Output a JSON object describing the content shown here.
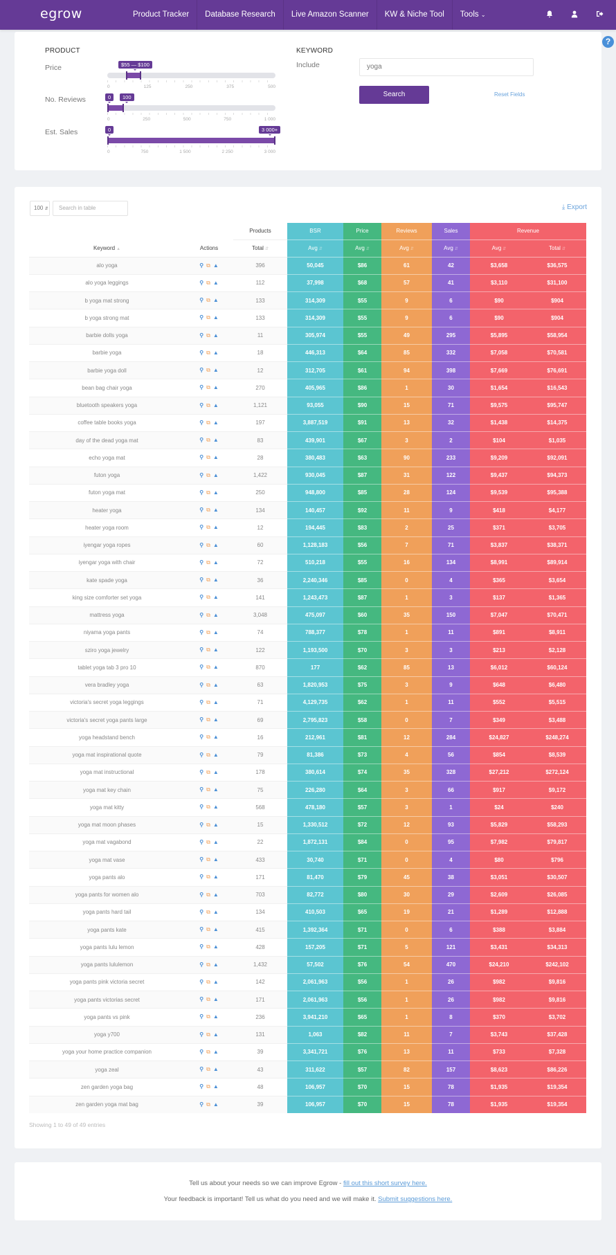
{
  "nav": {
    "logo": "egrow",
    "items": [
      "Product Tracker",
      "Database Research",
      "Live Amazon Scanner",
      "KW & Niche Tool",
      "Tools"
    ],
    "icons": [
      "bell-icon",
      "user-icon",
      "logout-icon"
    ]
  },
  "filters": {
    "product_title": "PRODUCT",
    "keyword_title": "KEYWORD",
    "price": {
      "label": "Price",
      "badge": "$55 — $100",
      "range": [
        55,
        100
      ],
      "max": 500,
      "ticks": [
        "0",
        "125",
        "250",
        "375",
        "500"
      ]
    },
    "reviews": {
      "label": "No. Reviews",
      "badge_min": "0",
      "badge_max": "100",
      "range": [
        0,
        100
      ],
      "max": 1000,
      "ticks": [
        "0",
        "250",
        "500",
        "750",
        "1 000"
      ]
    },
    "sales": {
      "label": "Est. Sales",
      "badge_min": "0",
      "badge_max": "3 000+",
      "range": [
        0,
        3000
      ],
      "max": 3000,
      "ticks": [
        "0",
        "750",
        "1 500",
        "2 250",
        "3 000"
      ]
    },
    "include_label": "Include",
    "include_value": "yoga",
    "search_button": "Search",
    "reset_link": "Reset Fields"
  },
  "table": {
    "page_length": "100",
    "search_placeholder": "Search in table",
    "export_label": "Export",
    "group_headers": {
      "products": "Products",
      "bsr": "BSR",
      "price": "Price",
      "reviews": "Reviews",
      "sales": "Sales",
      "revenue": "Revenue"
    },
    "columns": {
      "keyword": "Keyword",
      "actions": "Actions",
      "total": "Total",
      "bsr_avg": "Avg",
      "price_avg": "Avg",
      "reviews_avg": "Avg",
      "sales_avg": "Avg",
      "revenue_avg": "Avg",
      "revenue_total": "Total"
    },
    "colors": {
      "bsr": "#5bc5d1",
      "price": "#45b880",
      "reviews": "#f0a05a",
      "sales": "#8e68d3",
      "revenue": "#f3636b"
    },
    "rows": [
      [
        "alo yoga",
        "396",
        "50,045",
        "$86",
        "61",
        "42",
        "$3,658",
        "$36,575"
      ],
      [
        "alo yoga leggings",
        "112",
        "37,998",
        "$68",
        "57",
        "41",
        "$3,110",
        "$31,100"
      ],
      [
        "b yoga mat strong",
        "133",
        "314,309",
        "$55",
        "9",
        "6",
        "$90",
        "$904"
      ],
      [
        "b yoga strong mat",
        "133",
        "314,309",
        "$55",
        "9",
        "6",
        "$90",
        "$904"
      ],
      [
        "barbie dolls yoga",
        "11",
        "305,974",
        "$55",
        "49",
        "295",
        "$5,895",
        "$58,954"
      ],
      [
        "barbie yoga",
        "18",
        "446,313",
        "$64",
        "85",
        "332",
        "$7,058",
        "$70,581"
      ],
      [
        "barbie yoga doll",
        "12",
        "312,705",
        "$61",
        "94",
        "398",
        "$7,669",
        "$76,691"
      ],
      [
        "bean bag chair yoga",
        "270",
        "405,965",
        "$86",
        "1",
        "30",
        "$1,654",
        "$16,543"
      ],
      [
        "bluetooth speakers yoga",
        "1,121",
        "93,055",
        "$90",
        "15",
        "71",
        "$9,575",
        "$95,747"
      ],
      [
        "coffee table books yoga",
        "197",
        "3,887,519",
        "$91",
        "13",
        "32",
        "$1,438",
        "$14,375"
      ],
      [
        "day of the dead yoga mat",
        "83",
        "439,901",
        "$67",
        "3",
        "2",
        "$104",
        "$1,035"
      ],
      [
        "echo yoga mat",
        "28",
        "380,483",
        "$63",
        "90",
        "233",
        "$9,209",
        "$92,091"
      ],
      [
        "futon yoga",
        "1,422",
        "930,045",
        "$87",
        "31",
        "122",
        "$9,437",
        "$94,373"
      ],
      [
        "futon yoga mat",
        "250",
        "948,800",
        "$85",
        "28",
        "124",
        "$9,539",
        "$95,388"
      ],
      [
        "heater yoga",
        "134",
        "140,457",
        "$92",
        "11",
        "9",
        "$418",
        "$4,177"
      ],
      [
        "heater yoga room",
        "12",
        "194,445",
        "$83",
        "2",
        "25",
        "$371",
        "$3,705"
      ],
      [
        "iyengar yoga ropes",
        "60",
        "1,128,183",
        "$56",
        "7",
        "71",
        "$3,837",
        "$38,371"
      ],
      [
        "iyengar yoga with chair",
        "72",
        "510,218",
        "$55",
        "16",
        "134",
        "$8,991",
        "$89,914"
      ],
      [
        "kate spade yoga",
        "36",
        "2,240,346",
        "$85",
        "0",
        "4",
        "$365",
        "$3,654"
      ],
      [
        "king size comforter set yoga",
        "141",
        "1,243,473",
        "$87",
        "1",
        "3",
        "$137",
        "$1,365"
      ],
      [
        "mattress yoga",
        "3,048",
        "475,097",
        "$60",
        "35",
        "150",
        "$7,047",
        "$70,471"
      ],
      [
        "niyama yoga pants",
        "74",
        "788,377",
        "$78",
        "1",
        "11",
        "$891",
        "$8,911"
      ],
      [
        "sziro yoga jewelry",
        "122",
        "1,193,500",
        "$70",
        "3",
        "3",
        "$213",
        "$2,128"
      ],
      [
        "tablet yoga tab 3 pro 10",
        "870",
        "177",
        "$62",
        "85",
        "13",
        "$6,012",
        "$60,124"
      ],
      [
        "vera bradley yoga",
        "63",
        "1,820,953",
        "$75",
        "3",
        "9",
        "$648",
        "$6,480"
      ],
      [
        "victoria's secret yoga leggings",
        "71",
        "4,129,735",
        "$62",
        "1",
        "11",
        "$552",
        "$5,515"
      ],
      [
        "victoria's secret yoga pants large",
        "69",
        "2,795,823",
        "$58",
        "0",
        "7",
        "$349",
        "$3,488"
      ],
      [
        "yoga headstand bench",
        "16",
        "212,961",
        "$81",
        "12",
        "284",
        "$24,827",
        "$248,274"
      ],
      [
        "yoga mat inspirational quote",
        "79",
        "81,386",
        "$73",
        "4",
        "56",
        "$854",
        "$8,539"
      ],
      [
        "yoga mat instructional",
        "178",
        "380,614",
        "$74",
        "35",
        "328",
        "$27,212",
        "$272,124"
      ],
      [
        "yoga mat key chain",
        "75",
        "226,280",
        "$64",
        "3",
        "66",
        "$917",
        "$9,172"
      ],
      [
        "yoga mat kitty",
        "568",
        "478,180",
        "$57",
        "3",
        "1",
        "$24",
        "$240"
      ],
      [
        "yoga mat moon phases",
        "15",
        "1,330,512",
        "$72",
        "12",
        "93",
        "$5,829",
        "$58,293"
      ],
      [
        "yoga mat vagabond",
        "22",
        "1,872,131",
        "$84",
        "0",
        "95",
        "$7,982",
        "$79,817"
      ],
      [
        "yoga mat vase",
        "433",
        "30,740",
        "$71",
        "0",
        "4",
        "$80",
        "$796"
      ],
      [
        "yoga pants alo",
        "171",
        "81,470",
        "$79",
        "45",
        "38",
        "$3,051",
        "$30,507"
      ],
      [
        "yoga pants for women alo",
        "703",
        "82,772",
        "$80",
        "30",
        "29",
        "$2,609",
        "$26,085"
      ],
      [
        "yoga pants hard tail",
        "134",
        "410,503",
        "$65",
        "19",
        "21",
        "$1,289",
        "$12,888"
      ],
      [
        "yoga pants kate",
        "415",
        "1,392,364",
        "$71",
        "0",
        "6",
        "$388",
        "$3,884"
      ],
      [
        "yoga pants lulu lemon",
        "428",
        "157,205",
        "$71",
        "5",
        "121",
        "$3,431",
        "$34,313"
      ],
      [
        "yoga pants lululemon",
        "1,432",
        "57,502",
        "$76",
        "54",
        "470",
        "$24,210",
        "$242,102"
      ],
      [
        "yoga pants pink victoria secret",
        "142",
        "2,061,963",
        "$56",
        "1",
        "26",
        "$982",
        "$9,816"
      ],
      [
        "yoga pants victorias secret",
        "171",
        "2,061,963",
        "$56",
        "1",
        "26",
        "$982",
        "$9,816"
      ],
      [
        "yoga pants vs pink",
        "236",
        "3,941,210",
        "$65",
        "1",
        "8",
        "$370",
        "$3,702"
      ],
      [
        "yoga y700",
        "131",
        "1,063",
        "$82",
        "11",
        "7",
        "$3,743",
        "$37,428"
      ],
      [
        "yoga your home practice companion",
        "39",
        "3,341,721",
        "$76",
        "13",
        "11",
        "$733",
        "$7,328"
      ],
      [
        "yoga zeal",
        "43",
        "311,622",
        "$57",
        "82",
        "157",
        "$8,623",
        "$86,226"
      ],
      [
        "zen garden yoga bag",
        "48",
        "106,957",
        "$70",
        "15",
        "78",
        "$1,935",
        "$19,354"
      ],
      [
        "zen garden yoga mat bag",
        "39",
        "106,957",
        "$70",
        "15",
        "78",
        "$1,935",
        "$19,354"
      ]
    ],
    "footer_info": "Showing 1 to 49 of 49 entries"
  },
  "feedback": {
    "line1_text": "Tell us about your needs so we can improve Egrow - ",
    "line1_link": "fill out this short survey here.",
    "line2_text": "Your feedback is important! Tell us what do you need and we will make it. ",
    "line2_link": "Submit suggestions here."
  }
}
